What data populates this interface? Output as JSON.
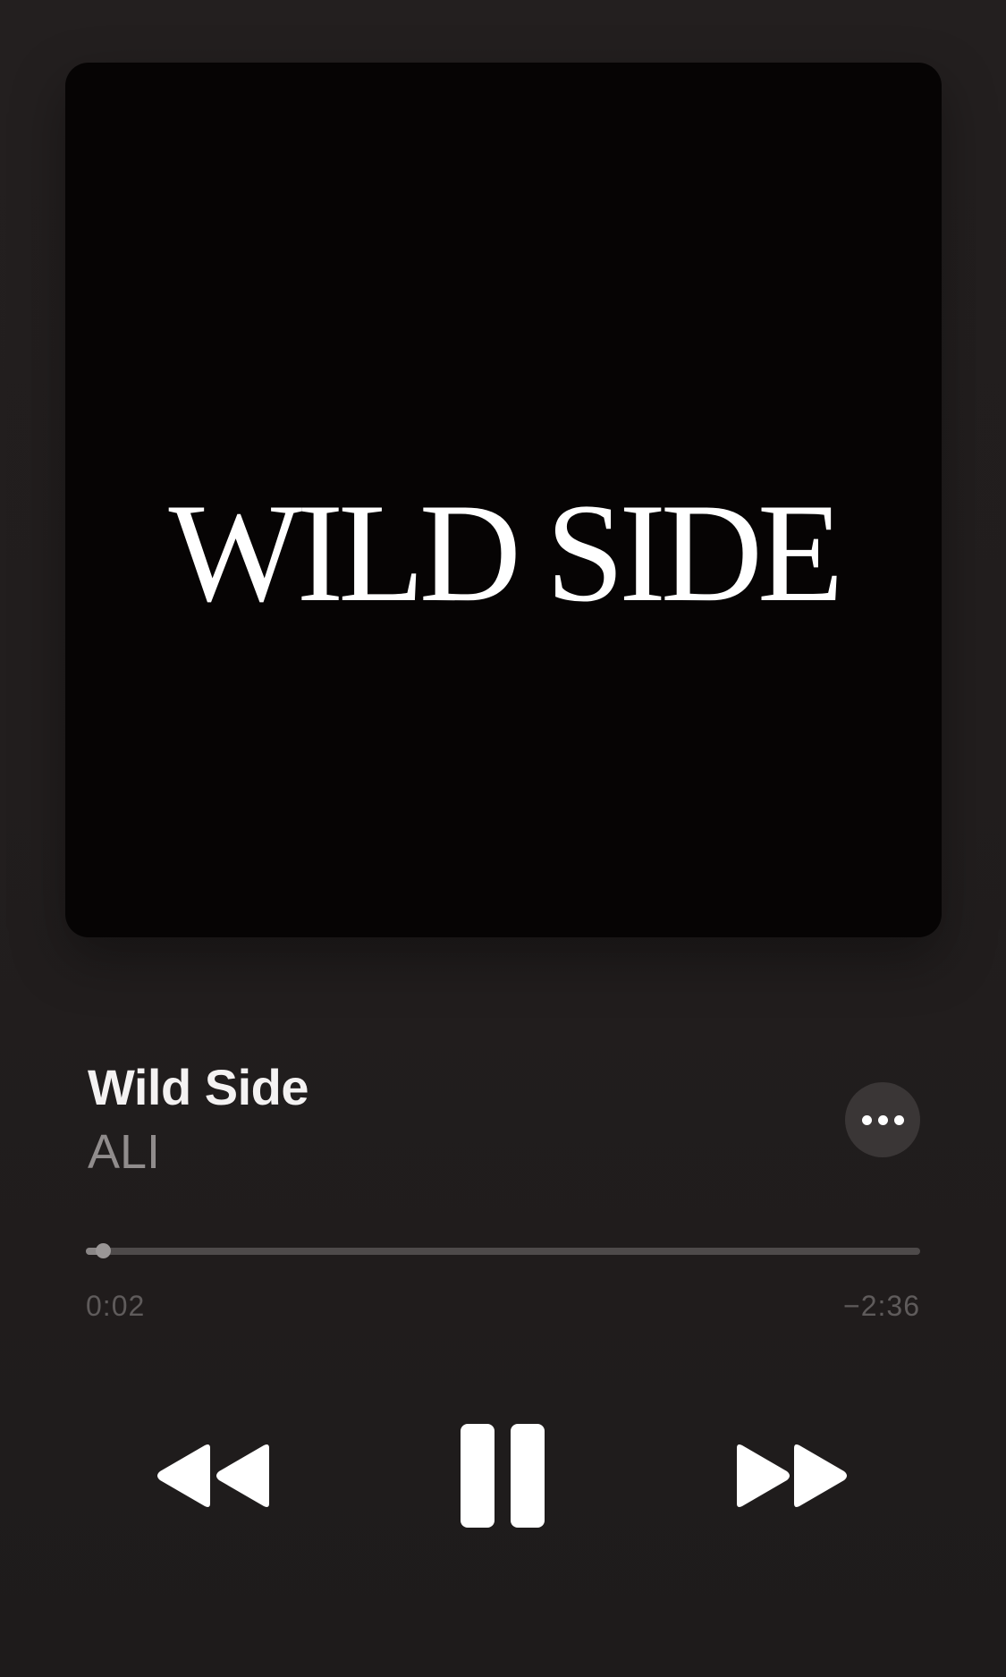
{
  "artwork": {
    "text": "WILD SIDE",
    "background_color": "#060404"
  },
  "track": {
    "title": "Wild Side",
    "artist": "ALI"
  },
  "more_button": {
    "icon": "ellipsis-icon"
  },
  "playback": {
    "elapsed": "0:02",
    "remaining": "−2:36",
    "progress_fraction": 0.02
  },
  "controls": {
    "rewind_icon": "rewind-icon",
    "pause_icon": "pause-icon",
    "forward_icon": "fast-forward-icon"
  }
}
